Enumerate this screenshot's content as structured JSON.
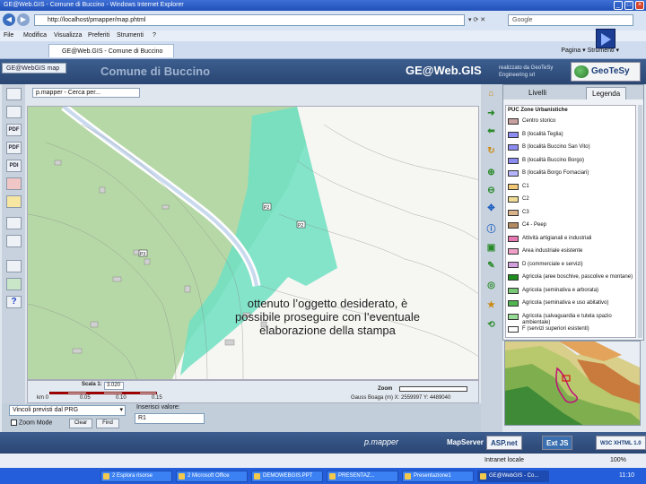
{
  "window": {
    "title": "GE@Web.GIS - Comune di Buccino - Windows Internet Explorer",
    "url": "http://localhost/pmapper/map.phtml",
    "search_placeholder": "Google",
    "min_glyph": "_",
    "max_glyph": "□",
    "close_glyph": "×"
  },
  "menu": [
    "File",
    "Modifica",
    "Visualizza",
    "Preferiti",
    "Strumenti",
    "?"
  ],
  "tabs": {
    "active": "GE@Web.GIS - Comune di Buccino",
    "tools": "Pagina  ▾   Strumenti  ▾"
  },
  "app": {
    "brand_tab": "GE@WebGIS map",
    "comune": "Comune di Buccino",
    "name": "GE@Web.GIS",
    "credit": "realizzato da GeoTeSy Engineering srl",
    "logo": "GeoTeSy"
  },
  "left_tools": [
    "",
    "",
    "PDF",
    "PDF",
    "PDI",
    "",
    "",
    "",
    "",
    "",
    "",
    "?"
  ],
  "map": {
    "search_label": "p.mapper - Cerca per...",
    "labels": [
      "P2",
      "P2",
      "P3"
    ],
    "overlay_text": "ottenuto l’oggetto desiderato, è possibile proseguire con l’eventuale elaborazione della stampa",
    "scale_label": "Scala 1:",
    "scale_value": "3.020",
    "zoom_label": "Zoom",
    "ticks": [
      "km 0",
      "0.05",
      "0.10",
      "0.15"
    ],
    "coords": "Gauss Boaga (m)  X: 2559997  Y: 4489040"
  },
  "bottom": {
    "select_value": "Vincoli previsti dal PRG",
    "zoom_mode": "Zoom Mode",
    "btn_clear": "Clear",
    "btn_find": "Find",
    "input_label": "Inserisci valore:",
    "input_value": "R1"
  },
  "legend": {
    "tab_layers": "Livelli",
    "tab_legend": "Legenda",
    "header": "PUC Zone Urbanistiche",
    "items": [
      {
        "label": "Centro storico",
        "color": "#c8a0a0"
      },
      {
        "label": "B (località Teglia)",
        "color": "#8c8cf0"
      },
      {
        "label": "B (località Buccino San Vito)",
        "color": "#8c8cf0"
      },
      {
        "label": "B (località Buccino Borgo)",
        "color": "#8c8cf0"
      },
      {
        "label": "B (località Borgo Fornaciari)",
        "color": "#b4b4ff"
      },
      {
        "label": "C1",
        "color": "#f0c878"
      },
      {
        "label": "C2",
        "color": "#f0dc96"
      },
      {
        "label": "C3",
        "color": "#dcb48c"
      },
      {
        "label": "C4 - Peep",
        "color": "#b48c64"
      },
      {
        "label": "Attività artigianali e industriali",
        "color": "#e678b4"
      },
      {
        "label": "Area industriale esistente",
        "color": "#f0a0c8"
      },
      {
        "label": "D (commerciale e servizi)",
        "color": "#d2a0dc"
      },
      {
        "label": "Agricola (aree boschive, pascolive e montane)",
        "color": "#1e8c1e"
      },
      {
        "label": "Agricola (seminativa e arborata)",
        "color": "#78c878"
      },
      {
        "label": "Agricola (seminativa e uso abitativo)",
        "color": "#50b450"
      },
      {
        "label": "Agricola (salvaguardia e tutela spazio ambientale)",
        "color": "#96dc96"
      },
      {
        "label": "F (servizi superiori esistenti)",
        "color": "#ffffff"
      }
    ]
  },
  "footer": {
    "pmapper": "p.mapper",
    "mapserver": "MapServer",
    "aspnet": "ASP.net",
    "extjs": "Ext JS",
    "xhtml": "W3C XHTML 1.0"
  },
  "taskbar": {
    "status": "Intranet locale",
    "zoom": "100%",
    "items": [
      "2 Esplora risorse",
      "2 Microsoft Office",
      "DEMOWEBGIS.PPT",
      "PRESENTAZ...",
      "Presentazione1",
      "GE@WebGIS - Co..."
    ],
    "clock": "11:10"
  }
}
